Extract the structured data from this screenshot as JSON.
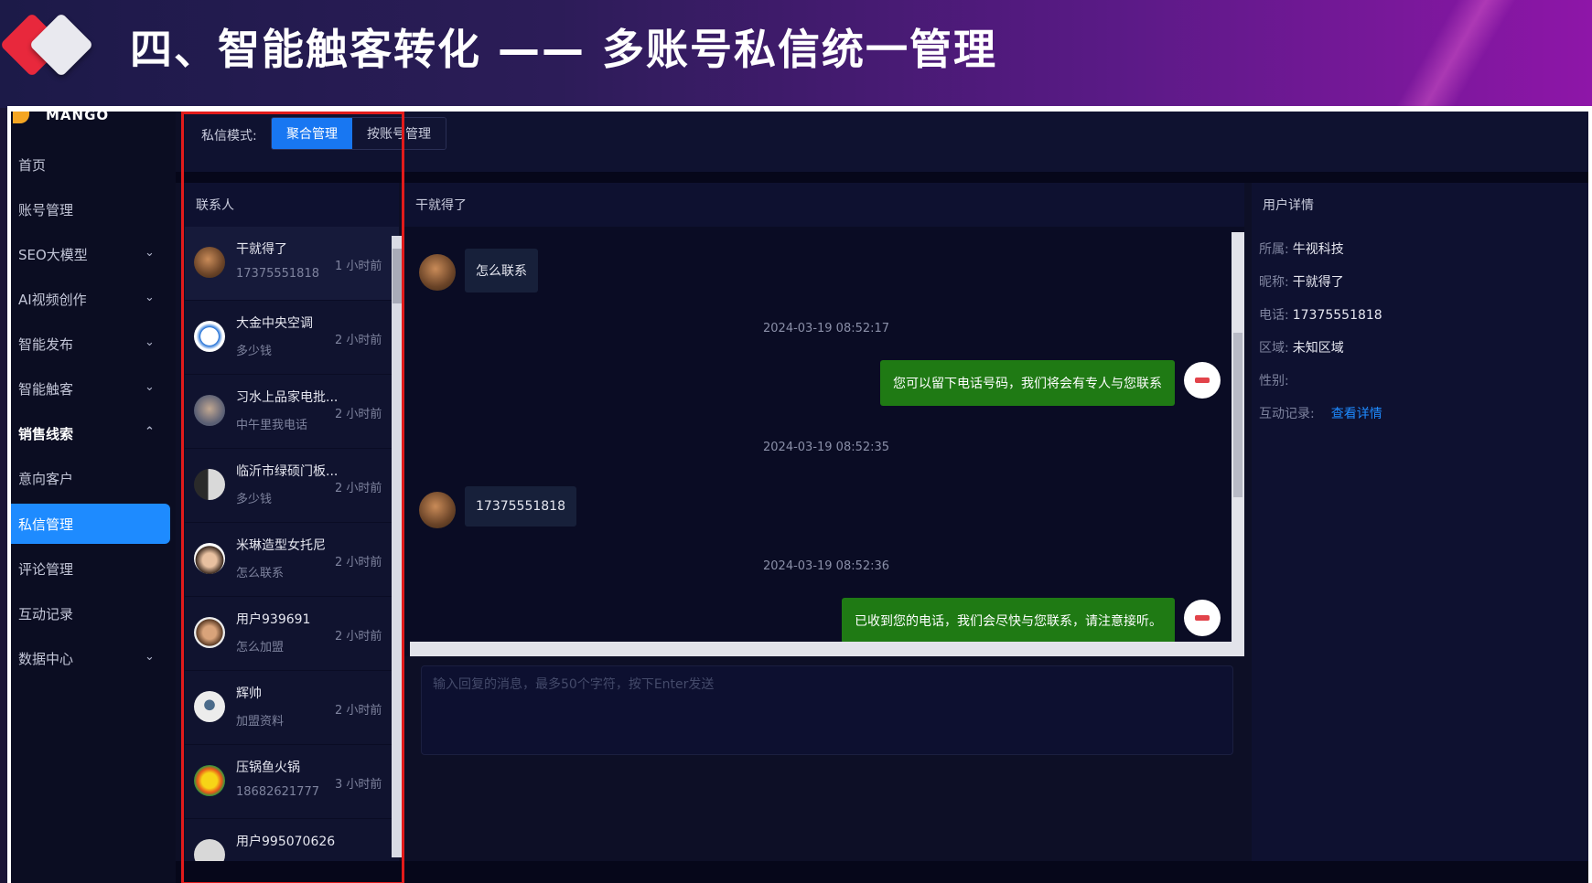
{
  "slide": {
    "title": "四、智能触客转化 —— 多账号私信统一管理"
  },
  "sidebar": {
    "brand": "MANGO",
    "items": [
      {
        "label": "首页",
        "chevron": ""
      },
      {
        "label": "账号管理",
        "chevron": ""
      },
      {
        "label": "SEO大模型",
        "chevron": "⌄"
      },
      {
        "label": "AI视频创作",
        "chevron": "⌄"
      },
      {
        "label": "智能发布",
        "chevron": "⌄"
      },
      {
        "label": "智能触客",
        "chevron": "⌄"
      },
      {
        "label": "销售线索",
        "chevron": "⌃"
      },
      {
        "label": "意向客户",
        "chevron": ""
      },
      {
        "label": "私信管理",
        "chevron": ""
      },
      {
        "label": "评论管理",
        "chevron": ""
      },
      {
        "label": "互动记录",
        "chevron": ""
      },
      {
        "label": "数据中心",
        "chevron": "⌄"
      }
    ]
  },
  "mode_bar": {
    "label": "私信模式:",
    "options": [
      "聚合管理",
      "按账号管理"
    ],
    "selected": "聚合管理"
  },
  "contacts": {
    "header": "联系人",
    "items": [
      {
        "name": "干就得了",
        "message": "17375551818",
        "time": "1 小时前"
      },
      {
        "name": "大金中央空调",
        "message": "多少钱",
        "time": "2 小时前"
      },
      {
        "name": "习水上品家电批...",
        "message": "中午里我电话",
        "time": "2 小时前"
      },
      {
        "name": "临沂市绿硕门板...",
        "message": "多少钱",
        "time": "2 小时前"
      },
      {
        "name": "米琳造型女托尼",
        "message": "怎么联系",
        "time": "2 小时前"
      },
      {
        "name": "用户939691",
        "message": "怎么加盟",
        "time": "2 小时前"
      },
      {
        "name": "辉帅",
        "message": "加盟资料",
        "time": "2 小时前"
      },
      {
        "name": "压锅鱼火锅",
        "message": "18682621777",
        "time": "3 小时前"
      },
      {
        "name": "用户995070626",
        "message": "",
        "time": ""
      }
    ]
  },
  "chat": {
    "header": "干就得了",
    "messages": [
      {
        "dir": "in",
        "text": "怎么联系"
      },
      {
        "dir": "ts",
        "text": "2024-03-19 08:52:17"
      },
      {
        "dir": "out",
        "text": "您可以留下电话号码，我们将会有专人与您联系"
      },
      {
        "dir": "ts",
        "text": "2024-03-19 08:52:35"
      },
      {
        "dir": "in",
        "text": "17375551818"
      },
      {
        "dir": "ts",
        "text": "2024-03-19 08:52:36"
      },
      {
        "dir": "out",
        "text": "已收到您的电话，我们会尽快与您联系，请注意接听。"
      }
    ],
    "input_placeholder": "输入回复的消息，最多50个字符，按下Enter发送"
  },
  "user_detail": {
    "header": "用户详情",
    "rows": [
      {
        "key": "所属:",
        "value": "牛视科技"
      },
      {
        "key": "昵称:",
        "value": "干就得了"
      },
      {
        "key": "电话:",
        "value": "17375551818"
      },
      {
        "key": "区域:",
        "value": "未知区域"
      },
      {
        "key": "性别:",
        "value": ""
      }
    ],
    "record_key": "互动记录:",
    "record_link": "查看详情"
  },
  "colors": {
    "accent": "#1e8bff",
    "outgoing_bubble": "#1f7a14",
    "highlight_box": "#e21b1b"
  }
}
